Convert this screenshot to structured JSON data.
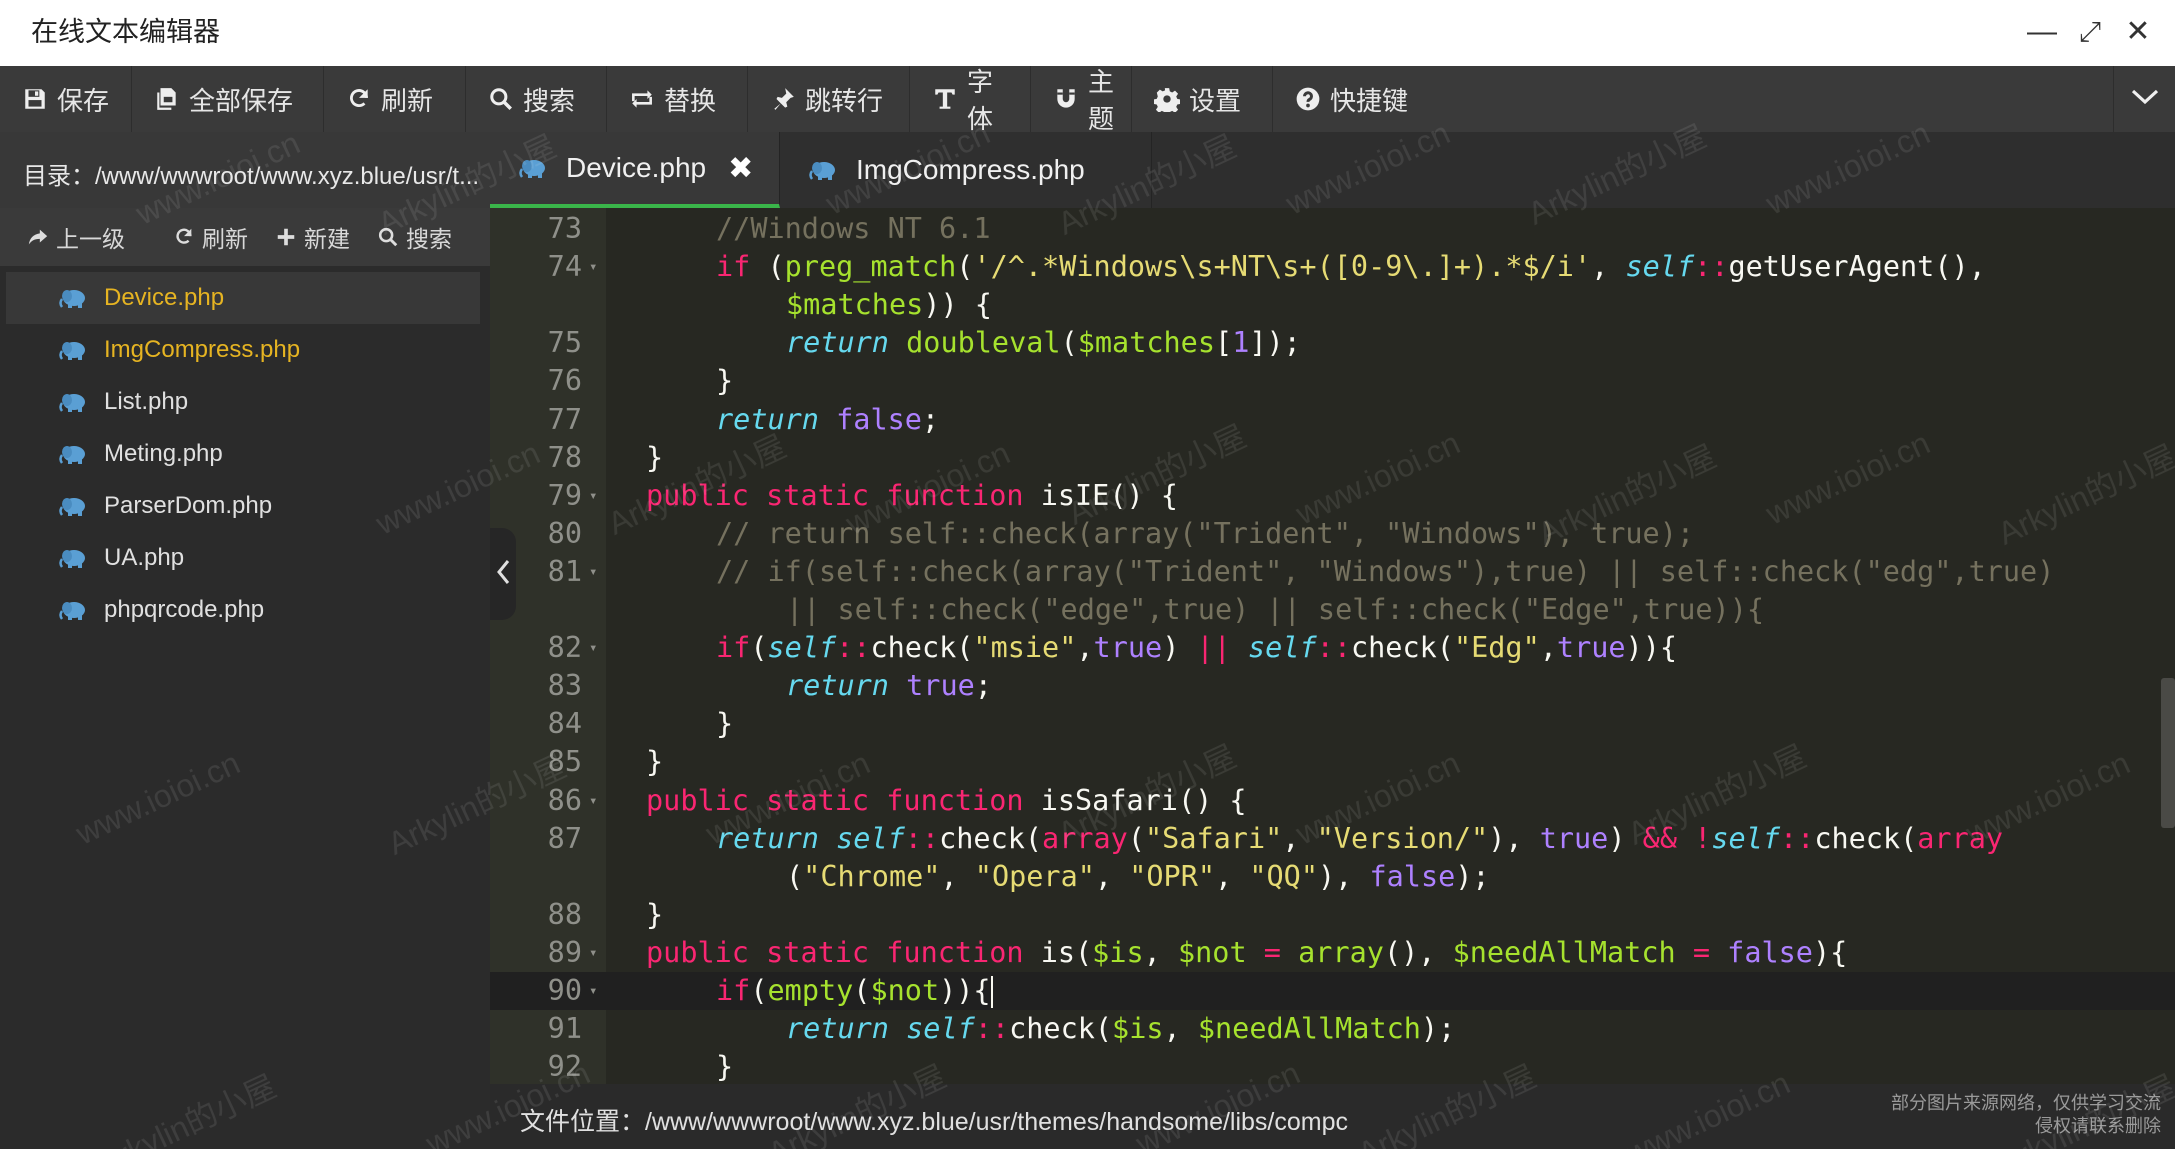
{
  "window": {
    "title": "在线文本编辑器",
    "minimize_label": "—",
    "maximize_label": "⤢",
    "close_label": "✕"
  },
  "toolbar": {
    "items": [
      {
        "label": "保存",
        "icon": "save-icon"
      },
      {
        "label": "全部保存",
        "icon": "save-all-icon"
      },
      {
        "label": "刷新",
        "icon": "refresh-icon"
      },
      {
        "label": "搜索",
        "icon": "search-icon"
      },
      {
        "label": "替换",
        "icon": "replace-icon"
      },
      {
        "label": "跳转行",
        "icon": "pin-icon"
      },
      {
        "label": "字体",
        "icon": "font-icon"
      },
      {
        "label": "主题",
        "icon": "magnet-icon"
      },
      {
        "label": "设置",
        "icon": "gear-icon"
      },
      {
        "label": "快捷键",
        "icon": "help-icon"
      }
    ]
  },
  "sidebar": {
    "dir_path": "目录：/www/wwwroot/www.xyz.blue/usr/t...",
    "actions": [
      {
        "label": "上一级",
        "icon": "share-icon"
      },
      {
        "label": "刷新",
        "icon": "refresh-icon"
      },
      {
        "label": "新建",
        "icon": "plus-icon"
      },
      {
        "label": "搜索",
        "icon": "search-icon"
      }
    ],
    "files": [
      {
        "name": "Device.php",
        "color": "#e6b422",
        "active": true
      },
      {
        "name": "ImgCompress.php",
        "color": "#e6b422",
        "active": false
      },
      {
        "name": "List.php",
        "color": "#e0e0e0",
        "active": false
      },
      {
        "name": "Meting.php",
        "color": "#e0e0e0",
        "active": false
      },
      {
        "name": "ParserDom.php",
        "color": "#e0e0e0",
        "active": false
      },
      {
        "name": "UA.php",
        "color": "#e0e0e0",
        "active": false
      },
      {
        "name": "phpqrcode.php",
        "color": "#e0e0e0",
        "active": false
      }
    ]
  },
  "tabs": [
    {
      "label": "Device.php",
      "active": true,
      "close": "✖"
    },
    {
      "label": "ImgCompress.php",
      "active": false
    }
  ],
  "editor": {
    "lines": [
      {
        "n": "73",
        "fold": false,
        "indent": 2,
        "segs": [
          [
            "cm",
            "//Windows NT 6.1"
          ]
        ]
      },
      {
        "n": "74",
        "fold": true,
        "indent": 2,
        "segs": [
          [
            "kw",
            "if"
          ],
          [
            "",
            " ("
          ],
          [
            "fn",
            "preg_match"
          ],
          [
            "",
            "("
          ],
          [
            "str",
            "'/^.*Windows\\s+NT\\s+([0-9\\.]+).*$/i'"
          ],
          [
            "",
            ", "
          ],
          [
            "sf",
            "self"
          ],
          [
            "kw",
            "::"
          ],
          [
            "",
            "getUserAgent(),"
          ]
        ]
      },
      {
        "n": "",
        "fold": false,
        "indent": 3,
        "segs": [
          [
            "var",
            "$matches"
          ],
          [
            "",
            ")) {"
          ]
        ]
      },
      {
        "n": "75",
        "fold": false,
        "indent": 3,
        "segs": [
          [
            "st",
            "return"
          ],
          [
            "",
            " "
          ],
          [
            "fn",
            "doubleval"
          ],
          [
            "",
            "("
          ],
          [
            "var",
            "$matches"
          ],
          [
            "",
            "["
          ],
          [
            "cnst",
            "1"
          ],
          [
            "",
            "]);"
          ]
        ]
      },
      {
        "n": "76",
        "fold": false,
        "indent": 2,
        "segs": [
          [
            "",
            "}"
          ]
        ]
      },
      {
        "n": "77",
        "fold": false,
        "indent": 2,
        "segs": [
          [
            "st",
            "return"
          ],
          [
            "",
            " "
          ],
          [
            "cnst",
            "false"
          ],
          [
            "",
            ";"
          ]
        ]
      },
      {
        "n": "78",
        "fold": false,
        "indent": 1,
        "segs": [
          [
            "",
            "}"
          ]
        ]
      },
      {
        "n": "79",
        "fold": true,
        "indent": 1,
        "segs": [
          [
            "kw",
            "public"
          ],
          [
            "",
            " "
          ],
          [
            "kw",
            "static"
          ],
          [
            "",
            " "
          ],
          [
            "kw",
            "function"
          ],
          [
            "",
            " isIE() {"
          ]
        ]
      },
      {
        "n": "80",
        "fold": false,
        "indent": 2,
        "segs": [
          [
            "cm",
            "// return self::check(array(\"Trident\", \"Windows\"), true);"
          ]
        ]
      },
      {
        "n": "81",
        "fold": true,
        "indent": 2,
        "segs": [
          [
            "cm",
            "// if(self::check(array(\"Trident\", \"Windows\"),true) || self::check(\"edg\",true)"
          ]
        ]
      },
      {
        "n": "",
        "fold": false,
        "indent": 3,
        "segs": [
          [
            "cm",
            "|| self::check(\"edge\",true) || self::check(\"Edge\",true)){"
          ]
        ]
      },
      {
        "n": "82",
        "fold": true,
        "indent": 2,
        "segs": [
          [
            "kw",
            "if"
          ],
          [
            "",
            "("
          ],
          [
            "sf",
            "self"
          ],
          [
            "kw",
            "::"
          ],
          [
            "",
            "check("
          ],
          [
            "str",
            "\"msie\""
          ],
          [
            "",
            ","
          ],
          [
            "cnst",
            "true"
          ],
          [
            "",
            ") "
          ],
          [
            "kw",
            "||"
          ],
          [
            "",
            " "
          ],
          [
            "sf",
            "self"
          ],
          [
            "kw",
            "::"
          ],
          [
            "",
            "check("
          ],
          [
            "str",
            "\"Edg\""
          ],
          [
            "",
            ","
          ],
          [
            "cnst",
            "true"
          ],
          [
            "",
            ")){"
          ]
        ]
      },
      {
        "n": "83",
        "fold": false,
        "indent": 3,
        "segs": [
          [
            "st",
            "return"
          ],
          [
            "",
            " "
          ],
          [
            "cnst",
            "true"
          ],
          [
            "",
            ";"
          ]
        ]
      },
      {
        "n": "84",
        "fold": false,
        "indent": 2,
        "segs": [
          [
            "",
            "}"
          ]
        ]
      },
      {
        "n": "85",
        "fold": false,
        "indent": 1,
        "segs": [
          [
            "",
            "}"
          ]
        ]
      },
      {
        "n": "86",
        "fold": true,
        "indent": 1,
        "segs": [
          [
            "kw",
            "public"
          ],
          [
            "",
            " "
          ],
          [
            "kw",
            "static"
          ],
          [
            "",
            " "
          ],
          [
            "kw",
            "function"
          ],
          [
            "",
            " isSafari() {"
          ]
        ]
      },
      {
        "n": "87",
        "fold": false,
        "indent": 2,
        "segs": [
          [
            "st",
            "return"
          ],
          [
            "",
            " "
          ],
          [
            "sf",
            "self"
          ],
          [
            "kw",
            "::"
          ],
          [
            "",
            "check("
          ],
          [
            "kw",
            "array"
          ],
          [
            "",
            "("
          ],
          [
            "str",
            "\"Safari\""
          ],
          [
            "",
            ", "
          ],
          [
            "str",
            "\"Version/\""
          ],
          [
            "",
            "), "
          ],
          [
            "cnst",
            "true"
          ],
          [
            "",
            ") "
          ],
          [
            "kw",
            "&&"
          ],
          [
            "",
            " "
          ],
          [
            "kw",
            "!"
          ],
          [
            "sf",
            "self"
          ],
          [
            "kw",
            "::"
          ],
          [
            "",
            "check("
          ],
          [
            "kw",
            "array"
          ]
        ]
      },
      {
        "n": "",
        "fold": false,
        "indent": 3,
        "segs": [
          [
            "",
            "("
          ],
          [
            "str",
            "\"Chrome\""
          ],
          [
            "",
            ", "
          ],
          [
            "str",
            "\"Opera\""
          ],
          [
            "",
            ", "
          ],
          [
            "str",
            "\"OPR\""
          ],
          [
            "",
            ", "
          ],
          [
            "str",
            "\"QQ\""
          ],
          [
            "",
            "), "
          ],
          [
            "cnst",
            "false"
          ],
          [
            "",
            ");"
          ]
        ]
      },
      {
        "n": "88",
        "fold": false,
        "indent": 1,
        "segs": [
          [
            "",
            "}"
          ]
        ]
      },
      {
        "n": "89",
        "fold": true,
        "indent": 1,
        "segs": [
          [
            "kw",
            "public"
          ],
          [
            "",
            " "
          ],
          [
            "kw",
            "static"
          ],
          [
            "",
            " "
          ],
          [
            "kw",
            "function"
          ],
          [
            "",
            " is("
          ],
          [
            "var",
            "$is"
          ],
          [
            "",
            ", "
          ],
          [
            "var",
            "$not"
          ],
          [
            "",
            " "
          ],
          [
            "kw",
            "="
          ],
          [
            "",
            " "
          ],
          [
            "fn",
            "array"
          ],
          [
            "",
            "(), "
          ],
          [
            "var",
            "$needAllMatch"
          ],
          [
            "",
            " "
          ],
          [
            "kw",
            "="
          ],
          [
            "",
            " "
          ],
          [
            "cnst",
            "false"
          ],
          [
            "",
            "){"
          ]
        ]
      },
      {
        "n": "90",
        "fold": true,
        "indent": 2,
        "active": true,
        "segs": [
          [
            "kw",
            "if"
          ],
          [
            "",
            "("
          ],
          [
            "fn",
            "empty"
          ],
          [
            "",
            "("
          ],
          [
            "var",
            "$not"
          ],
          [
            "",
            ")){"
          ],
          [
            "cursor",
            ""
          ]
        ]
      },
      {
        "n": "91",
        "fold": false,
        "indent": 3,
        "segs": [
          [
            "st",
            "return"
          ],
          [
            "",
            " "
          ],
          [
            "sf",
            "self"
          ],
          [
            "kw",
            "::"
          ],
          [
            "",
            "check("
          ],
          [
            "var",
            "$is"
          ],
          [
            "",
            ", "
          ],
          [
            "var",
            "$needAllMatch"
          ],
          [
            "",
            ");"
          ]
        ]
      },
      {
        "n": "92",
        "fold": false,
        "indent": 2,
        "segs": [
          [
            "",
            "}"
          ]
        ]
      }
    ]
  },
  "statusbar": {
    "file_location": "文件位置：/www/wwwroot/www.xyz.blue/usr/themes/handsome/libs/compc",
    "copyright_line1": "部分图片来源网络，仅供学习交流",
    "copyright_line2": "侵权请联系删除"
  },
  "watermark": {
    "text_a": "www.ioioi.cn",
    "text_b": "Arkylin的小屋"
  },
  "colors": {
    "accent_tab": "#3ab54a",
    "active_file": "#e6b422",
    "editor_bg": "#272822"
  }
}
